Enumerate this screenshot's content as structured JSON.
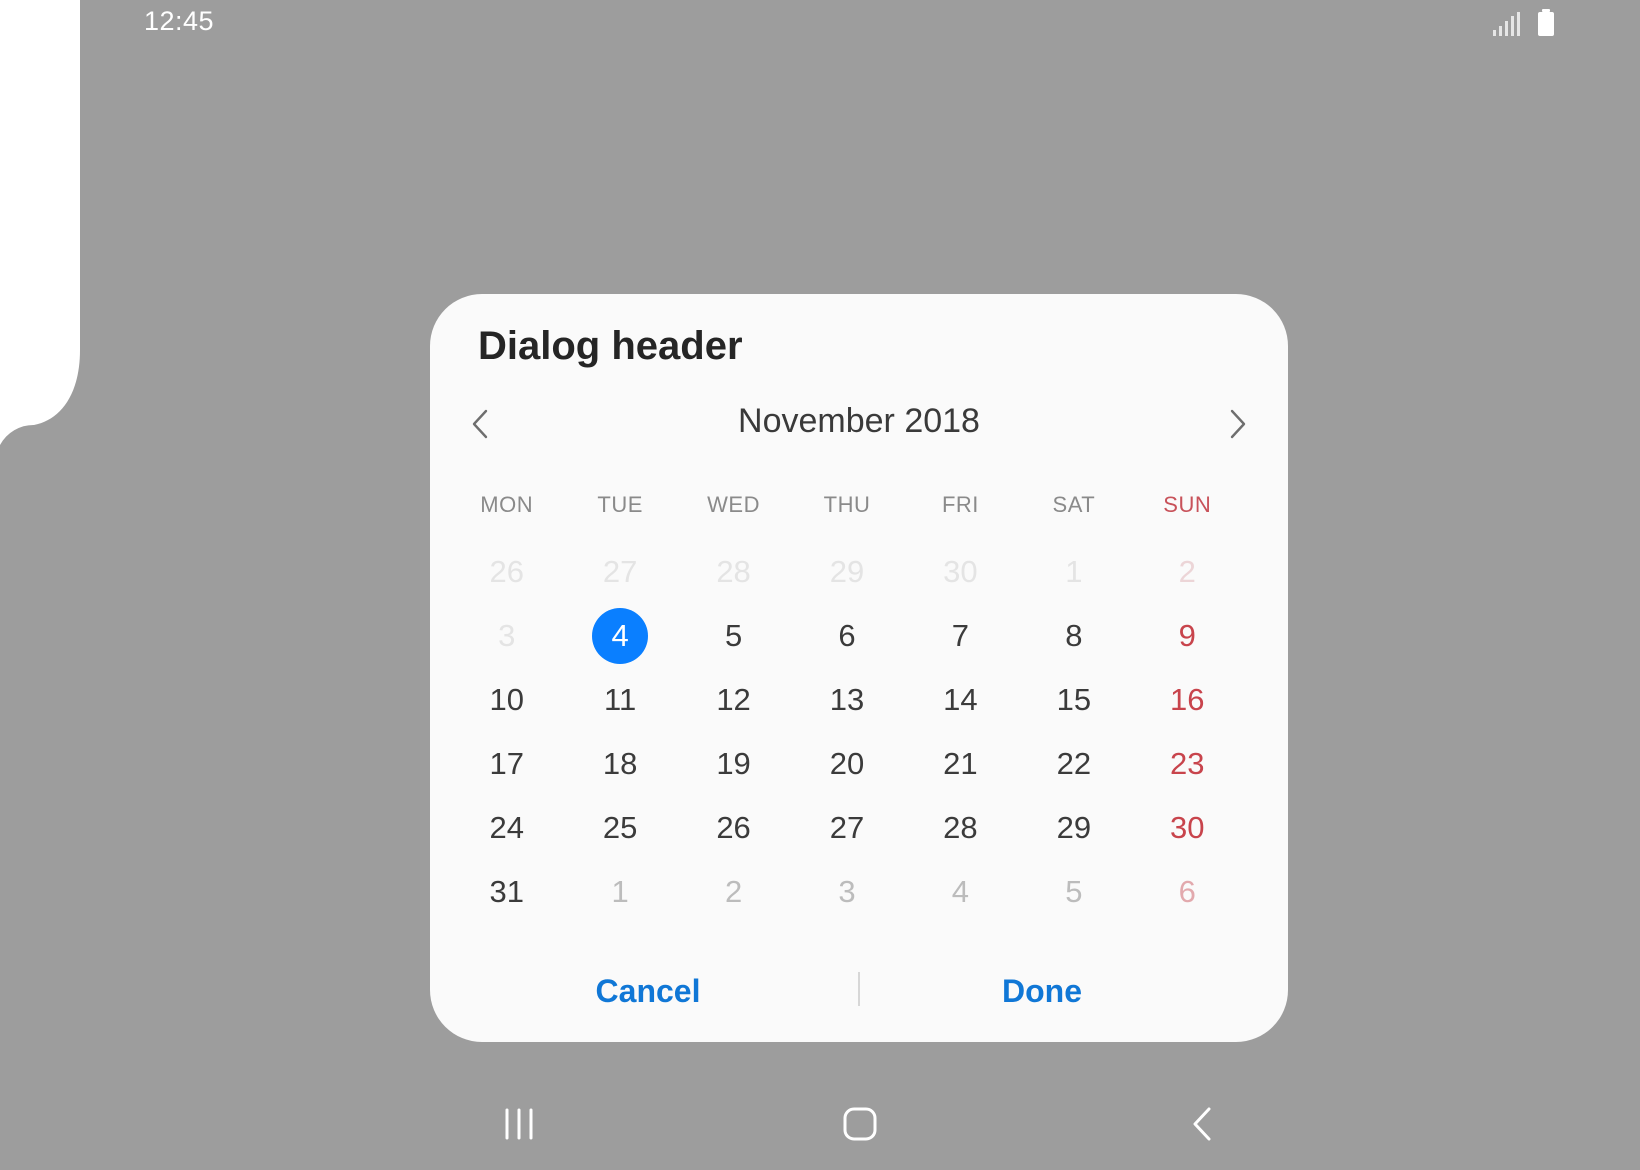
{
  "status_bar": {
    "time": "12:45"
  },
  "dialog": {
    "title": "Dialog header",
    "month_label": "November 2018",
    "weekdays": [
      "MON",
      "TUE",
      "WED",
      "THU",
      "FRI",
      "SAT",
      "SUN"
    ],
    "weeks": [
      [
        {
          "d": "26",
          "state": "faint"
        },
        {
          "d": "27",
          "state": "faint"
        },
        {
          "d": "28",
          "state": "faint"
        },
        {
          "d": "29",
          "state": "faint"
        },
        {
          "d": "30",
          "state": "faint"
        },
        {
          "d": "1",
          "state": "faint"
        },
        {
          "d": "2",
          "state": "faint"
        }
      ],
      [
        {
          "d": "3",
          "state": "faint"
        },
        {
          "d": "4",
          "state": "selected"
        },
        {
          "d": "5",
          "state": "normal"
        },
        {
          "d": "6",
          "state": "normal"
        },
        {
          "d": "7",
          "state": "normal"
        },
        {
          "d": "8",
          "state": "normal"
        },
        {
          "d": "9",
          "state": "normal"
        }
      ],
      [
        {
          "d": "10",
          "state": "normal"
        },
        {
          "d": "11",
          "state": "normal"
        },
        {
          "d": "12",
          "state": "normal"
        },
        {
          "d": "13",
          "state": "normal"
        },
        {
          "d": "14",
          "state": "normal"
        },
        {
          "d": "15",
          "state": "normal"
        },
        {
          "d": "16",
          "state": "normal"
        }
      ],
      [
        {
          "d": "17",
          "state": "normal"
        },
        {
          "d": "18",
          "state": "normal"
        },
        {
          "d": "19",
          "state": "normal"
        },
        {
          "d": "20",
          "state": "normal"
        },
        {
          "d": "21",
          "state": "normal"
        },
        {
          "d": "22",
          "state": "normal"
        },
        {
          "d": "23",
          "state": "normal"
        }
      ],
      [
        {
          "d": "24",
          "state": "normal"
        },
        {
          "d": "25",
          "state": "normal"
        },
        {
          "d": "26",
          "state": "normal"
        },
        {
          "d": "27",
          "state": "normal"
        },
        {
          "d": "28",
          "state": "normal"
        },
        {
          "d": "29",
          "state": "normal"
        },
        {
          "d": "30",
          "state": "normal"
        }
      ],
      [
        {
          "d": "31",
          "state": "normal"
        },
        {
          "d": "1",
          "state": "faded"
        },
        {
          "d": "2",
          "state": "faded"
        },
        {
          "d": "3",
          "state": "faded"
        },
        {
          "d": "4",
          "state": "faded"
        },
        {
          "d": "5",
          "state": "faded"
        },
        {
          "d": "6",
          "state": "faded"
        }
      ]
    ],
    "selected_day": "4",
    "cancel_label": "Cancel",
    "done_label": "Done"
  },
  "icons": {
    "prev": "chevron-left-icon",
    "next": "chevron-right-icon",
    "recents": "recents-icon",
    "home": "home-icon",
    "back": "back-icon"
  },
  "colors": {
    "scrim": "#9d9d9d",
    "dialog_bg": "#fafafa",
    "accent": "#0a7fff",
    "action_text": "#1077d6",
    "sunday": "#c8444c"
  }
}
